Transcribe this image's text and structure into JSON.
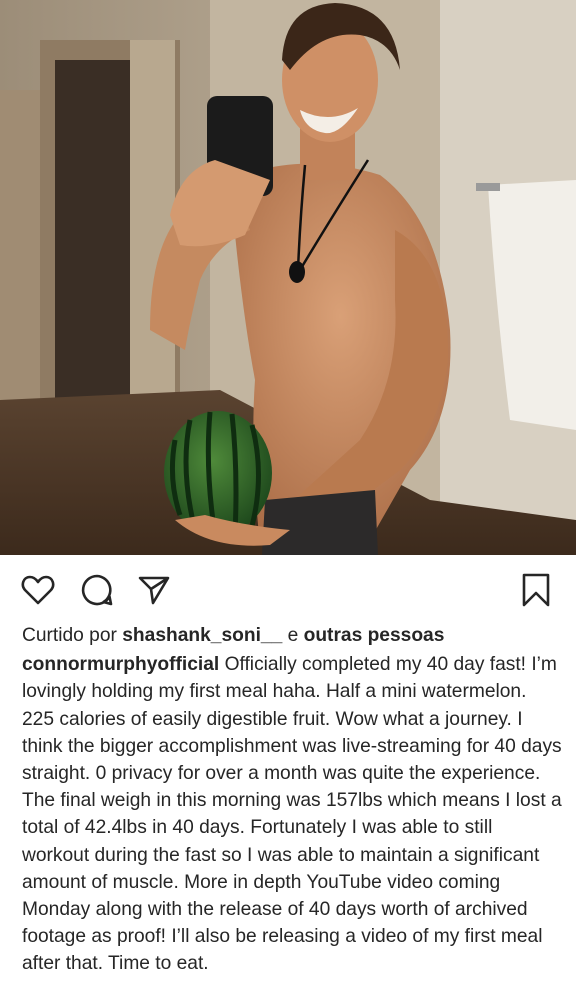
{
  "post": {
    "photo_alt": "Shirtless man taking a mirror selfie holding a watermelon",
    "icons": {
      "like": "heart-icon",
      "comment": "comment-bubble-icon",
      "share": "paper-plane-icon",
      "save": "bookmark-icon"
    },
    "likes": {
      "prefix": "Curtido por",
      "user": "shashank_soni__",
      "connector": "e",
      "others": "outras pessoas"
    },
    "caption": {
      "username": "connormurphyofficial",
      "text": "Officially completed my 40 day fast! I’m lovingly holding my first meal haha. Half a mini watermelon. 225 calories of easily digestible fruit. Wow what a journey. I think the bigger accomplishment was live-streaming for 40 days straight. 0 privacy for over a month was quite the experience. The final weigh in this morning was 157lbs which means I lost a total of 42.4lbs in 40 days. Fortunately I was able to still workout during the fast so I was able to maintain a significant amount of muscle. More in depth YouTube video coming Monday along with the release of 40 days worth of archived footage as proof! I’ll also be releasing a video of my first meal after that. Time to eat."
    }
  },
  "colors": {
    "text": "#262626",
    "icon": "#262626",
    "background": "#ffffff"
  }
}
